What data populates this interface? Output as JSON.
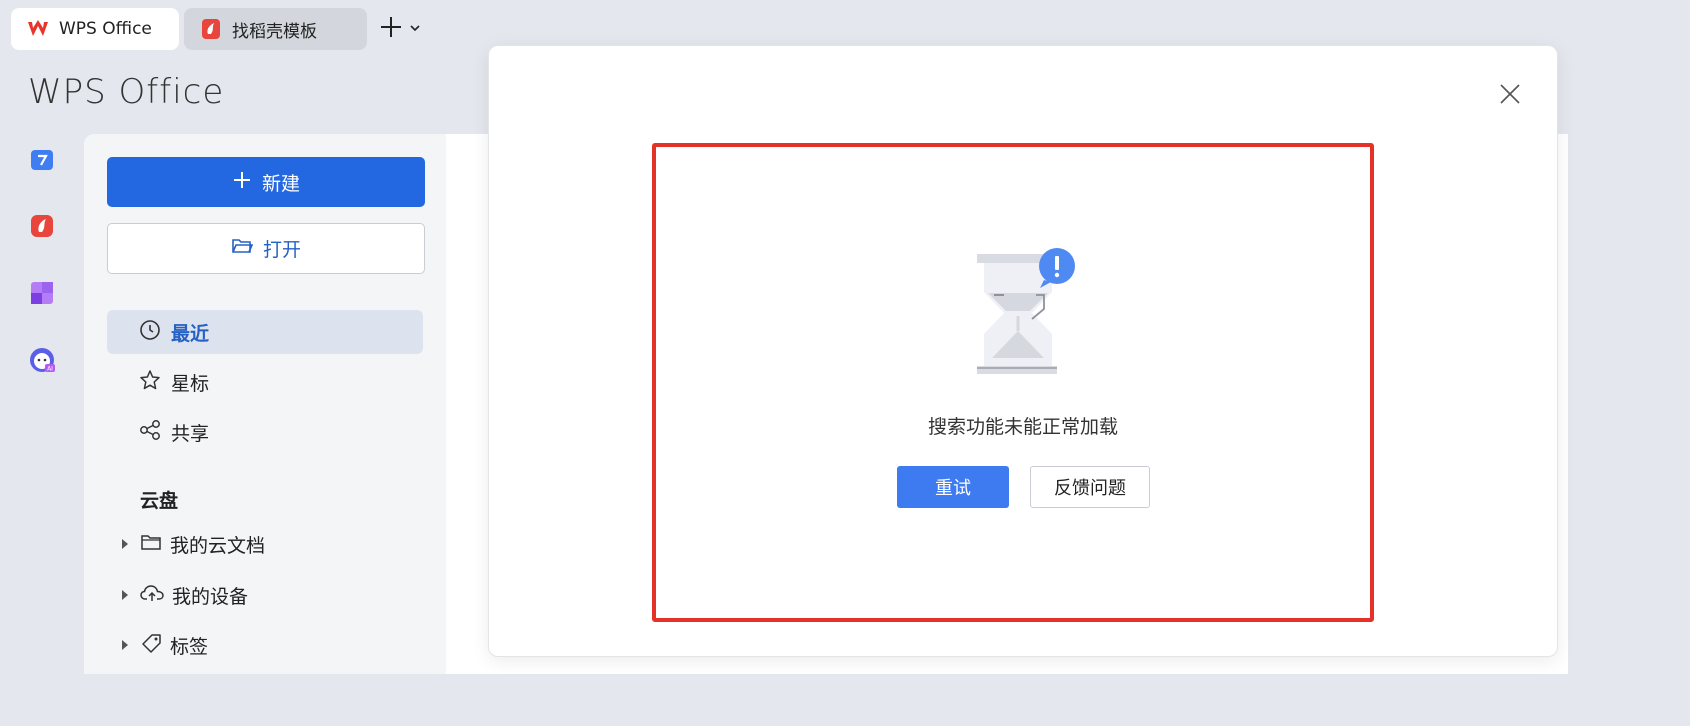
{
  "tabs": [
    {
      "label": "WPS Office",
      "icon": "wps-logo-icon"
    },
    {
      "label": "找稻壳模板",
      "icon": "docer-logo-icon"
    }
  ],
  "tabbar": {
    "new_tab_icon": "plus-icon",
    "dropdown_icon": "chevron-down-icon"
  },
  "brand": {
    "title": "WPS Office"
  },
  "rail": {
    "items": [
      "docs-app-icon",
      "docer-app-icon",
      "apps-app-icon",
      "ai-assistant-icon"
    ]
  },
  "sidebar": {
    "new_label": "新建",
    "open_label": "打开",
    "nav": [
      {
        "label": "最近",
        "icon": "clock-icon",
        "active": true
      },
      {
        "label": "星标",
        "icon": "star-icon",
        "active": false
      },
      {
        "label": "共享",
        "icon": "share-icon",
        "active": false
      }
    ],
    "cloud_title": "云盘",
    "tree": [
      {
        "label": "我的云文档",
        "icon": "folder-icon"
      },
      {
        "label": "我的设备",
        "icon": "cloud-upload-icon"
      },
      {
        "label": "标签",
        "icon": "tag-icon"
      }
    ]
  },
  "modal": {
    "message": "搜索功能未能正常加载",
    "retry_label": "重试",
    "feedback_label": "反馈问题",
    "highlight_color": "#e53228"
  },
  "colors": {
    "accent": "#2368e0",
    "retry": "#3e7bf0",
    "wps_red": "#e8352b"
  }
}
